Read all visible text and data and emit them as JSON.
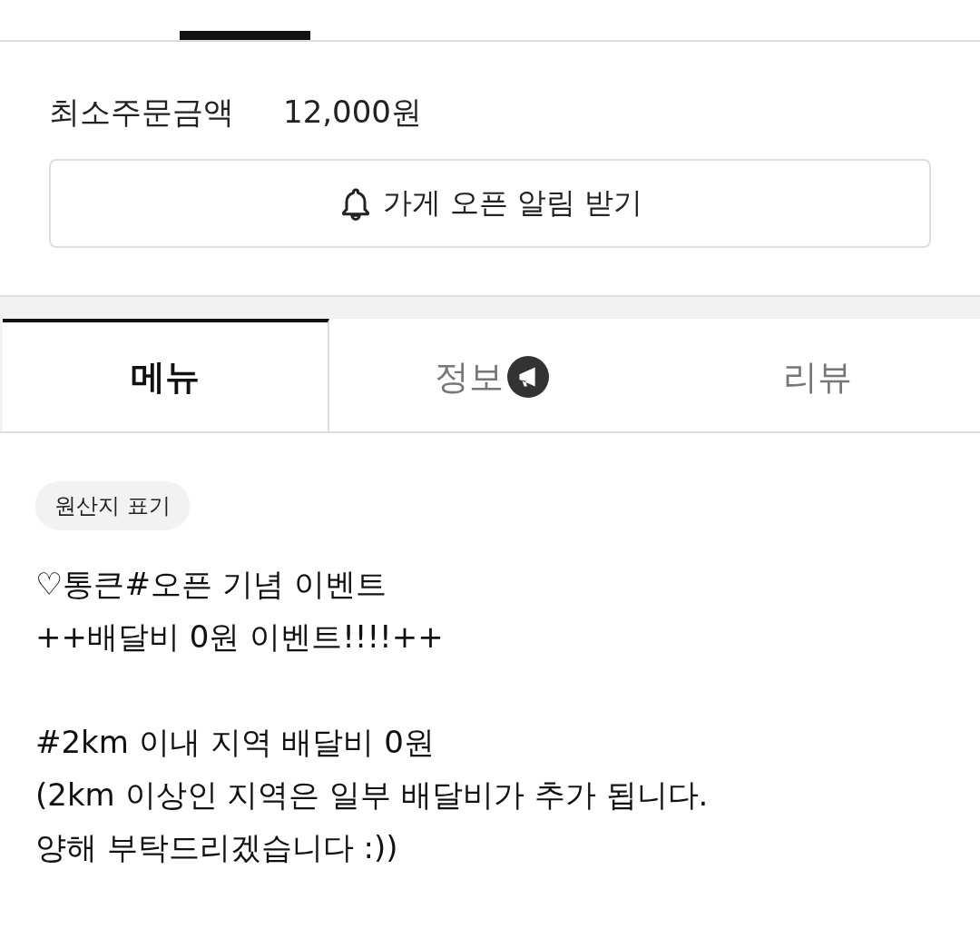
{
  "top_tabs": [
    {
      "selected": true
    },
    {
      "selected": false
    }
  ],
  "min_order": {
    "label": "최소주문금액",
    "value": "12,000원"
  },
  "notify_button": {
    "label": "가게 오픈 알림 받기"
  },
  "tabs": [
    {
      "label": "메뉴",
      "selected": true,
      "kind": "plain"
    },
    {
      "label": "정보",
      "selected": false,
      "kind": "with-icon"
    },
    {
      "label": "리뷰",
      "selected": false,
      "kind": "plain"
    }
  ],
  "origin_chip": "원산지 표기",
  "notice": "♡통큰#오픈 기념 이벤트\n++배달비 0원 이벤트!!!!++\n\n#2km 이내 지역 배달비 0원\n(2km 이상인 지역은 일부 배달비가 추가 됩니다.\n양해 부탁드리겠습니다 :))"
}
